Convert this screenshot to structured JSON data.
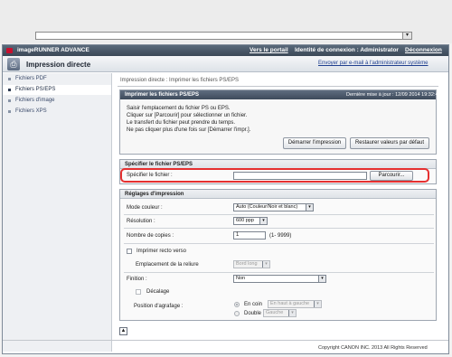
{
  "header": {
    "brand": "imageRUNNER ADVANCE",
    "portal_link": "Vers le portail",
    "login_info": "Identité de connexion : Administrator",
    "logout": "Déconnexion"
  },
  "function": {
    "title": "Impression directe",
    "mail_admin_link": "Envoyer par e-mail à l'administrateur système"
  },
  "sidebar": {
    "items": [
      {
        "label": "Fichiers PDF"
      },
      {
        "label": "Fichiers PS/EPS"
      },
      {
        "label": "Fichiers d'image"
      },
      {
        "label": "Fichiers XPS"
      }
    ]
  },
  "breadcrumb": "Impression directe : Imprimer les fichiers PS/EPS",
  "print_panel": {
    "title": "Imprimer les fichiers PS/EPS",
    "last_update": "Dernière mise à jour : 12/09 2014 19:32:44",
    "instructions": [
      "Saisir l'emplacement du fichier PS ou EPS.",
      "Cliquer sur [Parcourir] pour sélectionner un fichier.",
      "Le transfert du fichier peut prendre du temps.",
      "Ne pas cliquer plus d'une fois sur [Démarrer l'impr.]."
    ],
    "start_button": "Démarrer l'impression",
    "reset_button": "Restaurer valeurs par défaut"
  },
  "file_panel": {
    "title": "Spécifier le fichier PS/EPS",
    "file_label": "Spécifier le fichier :",
    "file_value": "",
    "browse_button": "Parcourir..."
  },
  "settings": {
    "title": "Réglages d'impression",
    "color_mode": {
      "label": "Mode couleur :",
      "value": "Auto (Couleur/Noir et blanc)"
    },
    "resolution": {
      "label": "Résolution :",
      "value": "600 ppp"
    },
    "copies": {
      "label": "Nombre de copies :",
      "value": "1",
      "range": "(1- 9999)"
    },
    "duplex": {
      "label": "Imprimer recto verso"
    },
    "binding": {
      "label": "Emplacement de la reliure",
      "value": "Bord long"
    },
    "finishing": {
      "label": "Finition :",
      "value": "Non"
    },
    "offset": {
      "label": "Décalage"
    },
    "staple": {
      "label": "Position d'agrafage :",
      "corner_label": "En coin",
      "corner_value": "En haut à gauche",
      "double_label": "Double",
      "double_value": "Gauche"
    }
  },
  "footer": {
    "top_icon": "top-arrow-icon",
    "copyright": "Copyright CANON INC. 2013 All Rights Reserved"
  }
}
